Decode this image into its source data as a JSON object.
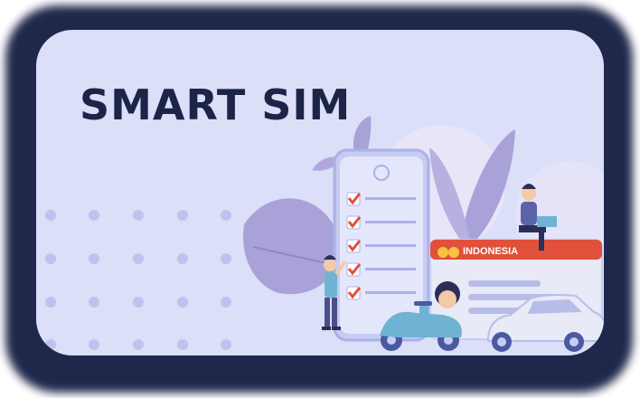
{
  "card": {
    "title": "SMART SIM"
  },
  "illustration": {
    "license_country": "INDONESIA",
    "colors": {
      "card_background": "#dbdff7",
      "frame": "#182146",
      "title": "#1c2447",
      "accent_red": "#e0503a",
      "leaf_purple": "#a9a2d8",
      "phone_blue": "#c7ccf3"
    }
  }
}
